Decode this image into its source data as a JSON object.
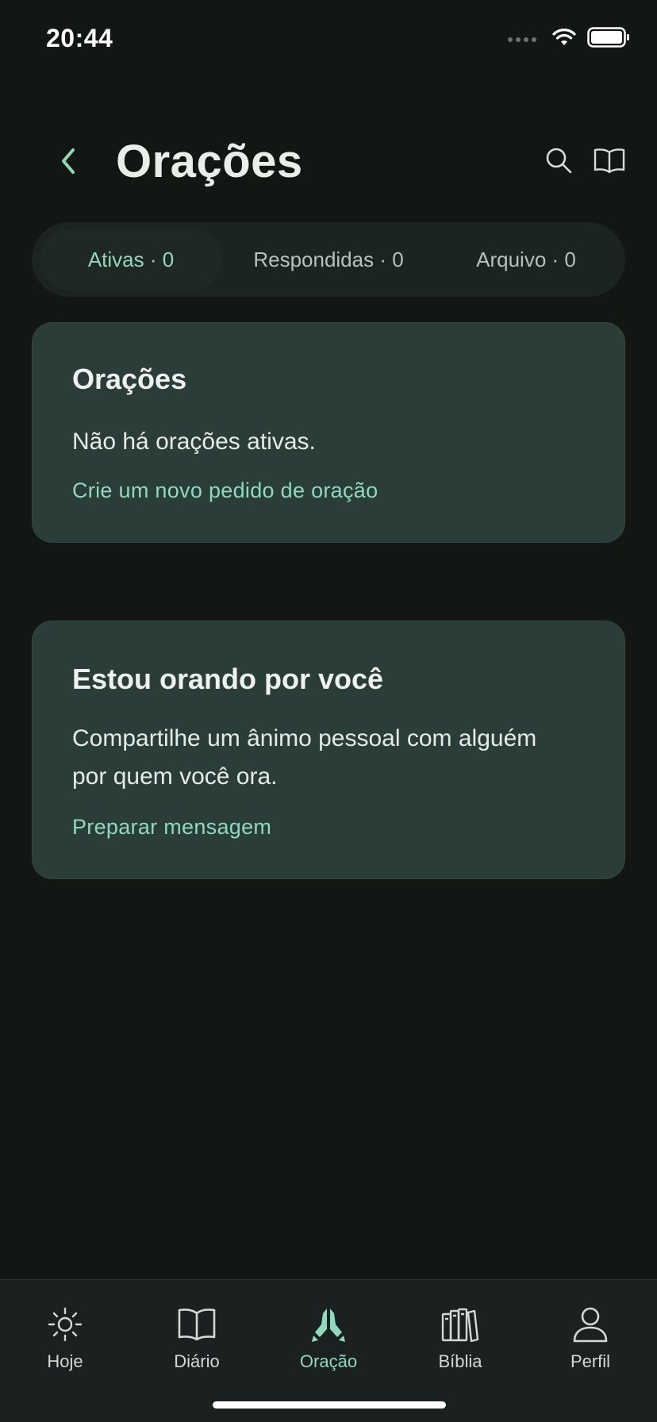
{
  "status_bar": {
    "time": "20:44"
  },
  "header": {
    "title": "Orações"
  },
  "tabs": [
    {
      "label": "Ativas · 0",
      "active": true
    },
    {
      "label": "Respondidas · 0",
      "active": false
    },
    {
      "label": "Arquivo · 0",
      "active": false
    }
  ],
  "cards": [
    {
      "title": "Orações",
      "body": "Não há orações ativas.",
      "link": "Crie um novo pedido de oração"
    },
    {
      "title": "Estou orando por você",
      "body": "Compartilhe um ânimo pessoal com alguém por quem você ora.",
      "link": "Preparar mensagem"
    }
  ],
  "nav": [
    {
      "label": "Hoje",
      "icon": "sun-icon",
      "active": false
    },
    {
      "label": "Diário",
      "icon": "open-book-icon",
      "active": false
    },
    {
      "label": "Oração",
      "icon": "praying-hands-icon",
      "active": true
    },
    {
      "label": "Bíblia",
      "icon": "books-icon",
      "active": false
    },
    {
      "label": "Perfil",
      "icon": "person-icon",
      "active": false
    }
  ],
  "colors": {
    "accent": "#8fd9bd",
    "background": "#121714",
    "card": "#2b3d39",
    "tab_bar": "#1a2120"
  }
}
